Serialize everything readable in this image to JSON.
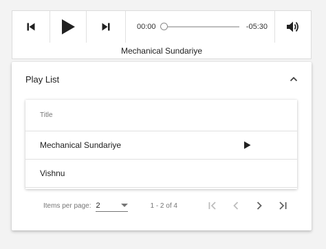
{
  "player": {
    "current_time": "00:00",
    "remaining_time": "-05:30",
    "progress": 0,
    "buttons": {
      "previous_icon": "skip-previous-icon",
      "play_icon": "play-icon",
      "next_icon": "skip-next-icon",
      "volume_icon": "volume-up-icon"
    }
  },
  "now_playing": "Mechanical Sundariye",
  "playlist": {
    "title": "Play List",
    "expanded": true,
    "column_title": "Title",
    "rows": [
      {
        "title": "Mechanical Sundariye",
        "playing": true
      },
      {
        "title": "Vishnu",
        "playing": false
      }
    ]
  },
  "paginator": {
    "items_per_page_label": "Items per page:",
    "items_per_page": "2",
    "range_label": "1 - 2 of 4"
  },
  "colors": {
    "icon": "#212121",
    "disabled_icon": "#bdbdbd",
    "nav_icon": "#616161"
  }
}
